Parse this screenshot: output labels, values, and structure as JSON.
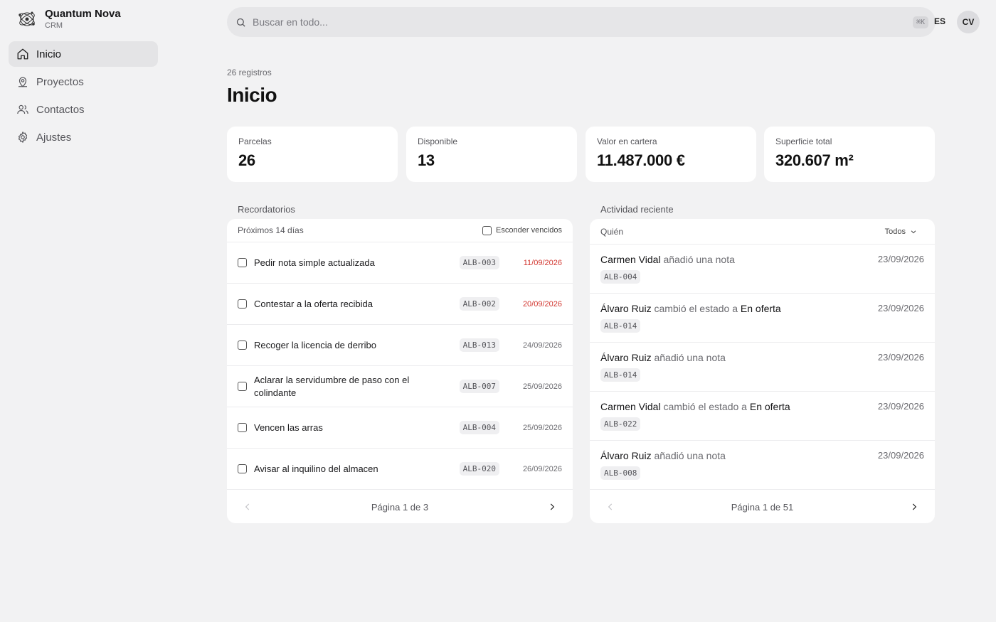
{
  "brand": {
    "name": "Quantum Nova",
    "subtitle": "CRM"
  },
  "nav": [
    {
      "label": "Inicio",
      "icon": "home-icon",
      "active": true
    },
    {
      "label": "Proyectos",
      "icon": "map-pin-icon",
      "active": false
    },
    {
      "label": "Contactos",
      "icon": "users-icon",
      "active": false
    },
    {
      "label": "Ajustes",
      "icon": "gear-icon",
      "active": false
    }
  ],
  "search": {
    "placeholder": "Buscar en todo...",
    "shortcut": "⌘K"
  },
  "header": {
    "language": "ES",
    "avatar_initials": "CV"
  },
  "page": {
    "count": "26 registros",
    "title": "Inicio"
  },
  "stats": [
    {
      "label": "Parcelas",
      "value": "26"
    },
    {
      "label": "Disponible",
      "value": "13"
    },
    {
      "label": "Valor en cartera",
      "value": "11.487.000 €"
    },
    {
      "label": "Superficie total",
      "value": "320.607 m²"
    }
  ],
  "reminders": {
    "title": "Recordatorios",
    "range_label": "Próximos 14 días",
    "hide_overdue_label": "Esconder vencidos",
    "items": [
      {
        "text": "Pedir nota simple actualizada",
        "tag": "ALB-003",
        "date": "11/09/2026",
        "overdue": true
      },
      {
        "text": "Contestar a la oferta recibida",
        "tag": "ALB-002",
        "date": "20/09/2026",
        "overdue": true
      },
      {
        "text": "Recoger la licencia de derribo",
        "tag": "ALB-013",
        "date": "24/09/2026",
        "overdue": false
      },
      {
        "text": "Aclarar la servidumbre de paso con el colindante",
        "tag": "ALB-007",
        "date": "25/09/2026",
        "overdue": false
      },
      {
        "text": "Vencen las arras",
        "tag": "ALB-004",
        "date": "25/09/2026",
        "overdue": false
      },
      {
        "text": "Avisar al inquilino del almacen",
        "tag": "ALB-020",
        "date": "26/09/2026",
        "overdue": false
      }
    ],
    "pagination": "Página 1 de 3"
  },
  "activity": {
    "title": "Actividad reciente",
    "column_label": "Quién",
    "filter_label": "Todos",
    "items": [
      {
        "who": "Carmen Vidal",
        "action": " añadió una nota",
        "state": "",
        "tag": "ALB-004",
        "date": "23/09/2026"
      },
      {
        "who": "Álvaro Ruiz",
        "action": " cambió el estado a ",
        "state": "En oferta",
        "tag": "ALB-014",
        "date": "23/09/2026"
      },
      {
        "who": "Álvaro Ruiz",
        "action": " añadió una nota",
        "state": "",
        "tag": "ALB-014",
        "date": "23/09/2026"
      },
      {
        "who": "Carmen Vidal",
        "action": " cambió el estado a ",
        "state": "En oferta",
        "tag": "ALB-022",
        "date": "23/09/2026"
      },
      {
        "who": "Álvaro Ruiz",
        "action": " añadió una nota",
        "state": "",
        "tag": "ALB-008",
        "date": "23/09/2026"
      }
    ],
    "pagination": "Página 1 de 51"
  },
  "colors": {
    "overdue": "#d2362f",
    "active_nav": "#e4e4e6",
    "background": "#f2f2f3"
  }
}
